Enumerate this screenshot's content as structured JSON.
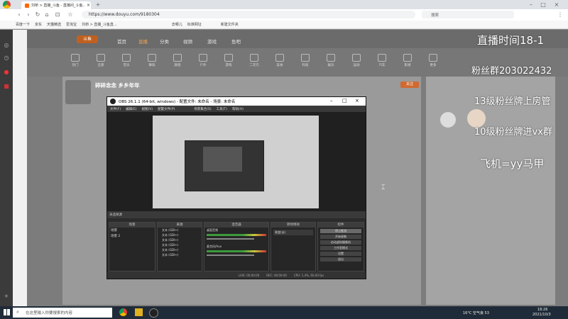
{
  "browser": {
    "tab_title": "刘桥 > 直播_斗鱼 - 直播间_斗鱼...",
    "url": "https://www.douyu.com/9180304",
    "search_placeholder": "搜索",
    "bookmarks": [
      "百度一下",
      "京东",
      "天猫精选",
      "爱淘宝",
      "刘桥 > 直播_斗鱼直...",
      "去哪儿",
      "标准网址",
      "新建文件夹"
    ]
  },
  "site": {
    "logo": "斗鱼",
    "nav": [
      "首页",
      "直播",
      "分类",
      "视频",
      "游戏",
      "鱼吧"
    ],
    "categories": [
      "热门",
      "全部",
      "音乐",
      "舞蹈",
      "颜值",
      "户外",
      "游戏",
      "二次元",
      "美食",
      "科技",
      "娱乐",
      "运动",
      "汽车",
      "影视",
      "更多"
    ],
    "room_title": "碎碎念念  乡乡年年",
    "follow_label": "关注"
  },
  "obs": {
    "title": "OBS 26.1.1 (64-bit, windows) - 配置文件: 未命名 - 场景: 未命名",
    "menu": [
      "文件(F)",
      "编辑(E)",
      "视图(V)",
      "配置文件(P)",
      "场景集合(S)",
      "工具(T)",
      "帮助(H)"
    ],
    "scene_label": "未选择源",
    "docks": {
      "scenes": "场景",
      "sources": "来源",
      "mixer": "混音器",
      "transitions": "转场特效",
      "controls": "控件"
    },
    "scene_items": [
      "场景",
      "场景 2"
    ],
    "source_items": [
      "文本 (GDI+)",
      "文本 (GDI+)",
      "文本 (GDI+)",
      "文本 (GDI+)",
      "文本 (GDI+)",
      "文本 (GDI+)"
    ],
    "mixer_items": [
      "桌面音频",
      "麦克风/Aux"
    ],
    "transition_value": "渐变(淡)",
    "control_buttons": [
      "停止推流",
      "开始录制",
      "启动虚拟摄像机",
      "工作室模式",
      "设置",
      "退出"
    ],
    "status": [
      "LIVE: 00:00:00",
      "REC: 00:00:00",
      "CPU: 1.4%, 60.00 fps"
    ]
  },
  "overlay": {
    "line1": "直播时间18-1",
    "line2": "粉丝群203022432",
    "line3": "13级粉丝牌上房管",
    "line4": "10级粉丝牌进vx群",
    "line5": "飞机=yy马甲"
  },
  "taskbar": {
    "search_placeholder": "在这里输入你要搜索的内容",
    "weather": "16°C 空气良 53",
    "time": "18:26",
    "date": "2021/10/3"
  }
}
